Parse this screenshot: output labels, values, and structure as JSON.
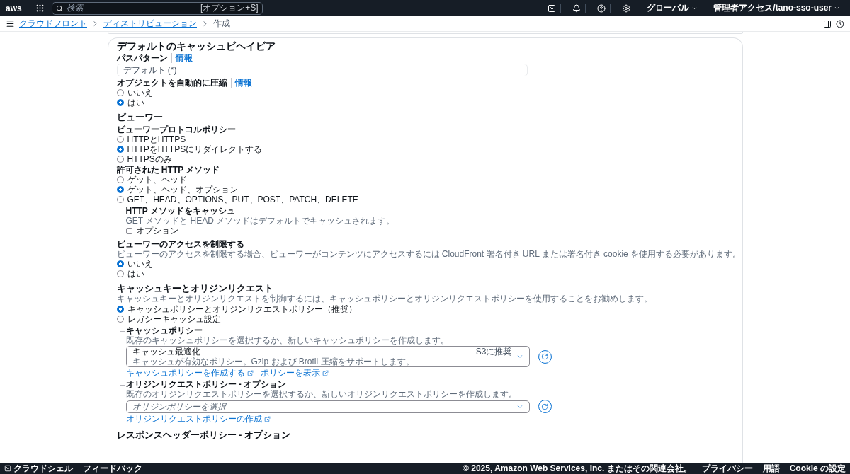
{
  "top_bar": {
    "logo": "aws",
    "search_placeholder": "検索",
    "shortcut": "[オプション+S]",
    "region": "グローバル",
    "account": "管理者アクセス/tano-sso-user"
  },
  "breadcrumbs": [
    {
      "label": "クラウドフロント",
      "link": true
    },
    {
      "label": "ディストリビューション",
      "link": true
    },
    {
      "label": "作成",
      "link": false
    }
  ],
  "form": {
    "title": "デフォルトのキャッシュビヘイビア",
    "path_pattern": {
      "label": "パスパターン",
      "info": "情報",
      "value": "デフォルト (*)"
    },
    "compress": {
      "label": "オブジェクトを自動的に圧縮",
      "info": "情報",
      "options": [
        {
          "label": "いいえ",
          "selected": false
        },
        {
          "label": "はい",
          "selected": true
        }
      ]
    },
    "viewer": {
      "title": "ビューワー",
      "protocol": {
        "label": "ビューワープロトコルポリシー",
        "options": [
          {
            "label": "HTTPとHTTPS",
            "selected": false
          },
          {
            "label": "HTTPをHTTPSにリダイレクトする",
            "selected": true
          },
          {
            "label": "HTTPSのみ",
            "selected": false
          }
        ]
      },
      "methods": {
        "label": "許可された HTTP メソッド",
        "options": [
          {
            "label": "ゲット、ヘッド",
            "selected": false
          },
          {
            "label": "ゲット、ヘッド、オプション",
            "selected": true
          },
          {
            "label": "GET、HEAD、OPTIONS、PUT、POST、PATCH、DELETE",
            "selected": false
          }
        ],
        "cache_methods": {
          "label": "HTTP メソッドをキャッシュ",
          "description": "GET メソッドと HEAD メソッドはデフォルトでキャッシュされます。",
          "checkbox": {
            "label": "オプション",
            "checked": false
          }
        }
      },
      "restrict": {
        "label": "ビューワーのアクセスを制限する",
        "description": "ビューワーのアクセスを制限する場合、ビューワーがコンテンツにアクセスするには CloudFront 署名付き URL または署名付き cookie を使用する必要があります。",
        "options": [
          {
            "label": "いいえ",
            "selected": true
          },
          {
            "label": "はい",
            "selected": false
          }
        ]
      }
    },
    "cache_key": {
      "title": "キャッシュキーとオリジンリクエスト",
      "description": "キャッシュキーとオリジンリクエストを制御するには、キャッシュポリシーとオリジンリクエストポリシーを使用することをお勧めします。",
      "options": [
        {
          "label": "キャッシュポリシーとオリジンリクエストポリシー（推奨）",
          "selected": true
        },
        {
          "label": "レガシーキャッシュ設定",
          "selected": false
        }
      ],
      "cache_policy": {
        "label": "キャッシュポリシー",
        "description": "既存のキャッシュポリシーを選択するか、新しいキャッシュポリシーを作成します。",
        "value": "キャッシュ最適化",
        "value_description": "キャッシュが有効なポリシー。Gzip および Brotli 圧縮をサポートします。",
        "badge": "S3に推奨",
        "links": [
          "キャッシュポリシーを作成する",
          "ポリシーを表示"
        ]
      },
      "origin_policy": {
        "label": "オリジンリクエストポリシー - オプション",
        "description": "既存のオリジンリクエストポリシーを選択するか、新しいオリジンリクエストポリシーを作成します。",
        "placeholder": "オリジンポリシーを選択",
        "links": [
          "オリジンリクエストポリシーの作成"
        ]
      }
    },
    "next_title": "レスポンスヘッダーポリシー - オプション"
  },
  "footer": {
    "cloudshell": "クラウドシェル",
    "feedback": "フィードバック",
    "copyright": "© 2025, Amazon Web Services, Inc. またはその関連会社。",
    "links": [
      "プライバシー",
      "用語",
      "Cookie の設定"
    ]
  }
}
